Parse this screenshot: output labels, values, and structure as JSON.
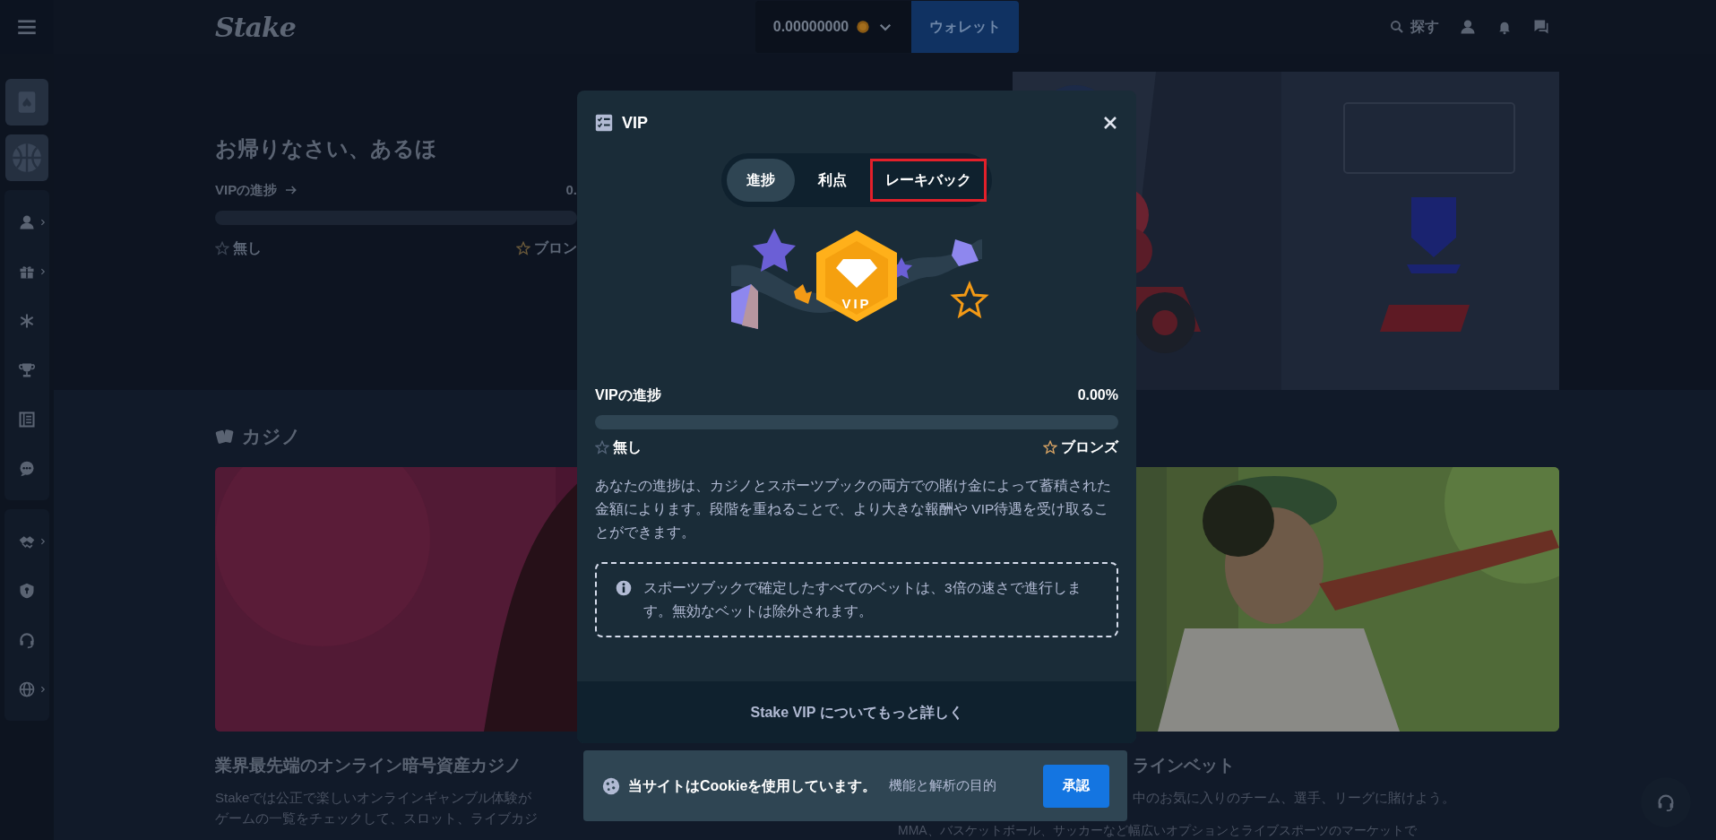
{
  "topbar": {
    "logo": "Stake",
    "balance": "0.00000000",
    "wallet_button": "ウォレット",
    "search_label": "探す"
  },
  "welcome": {
    "title": "お帰りなさい、あるほ",
    "progress_label": "VIPの進捗",
    "progress_value": "0.",
    "level": 0,
    "tier_current": "無し",
    "tier_next": "ブロン"
  },
  "casino": {
    "heading": "カジノ",
    "cards": [
      {
        "title": "業界最先端のオンライン暗号資産カジノ",
        "lines": [
          "Stakeでは公正で楽しいオンラインギャンブル体験が",
          "ゲームの一覧をチェックして、スロット、ライブカジ"
        ]
      },
      {
        "title": "ラインベット",
        "lines": [
          "中のお気に入りのチーム、選手、リーグに賭けよう。",
          "MMA、バスケットボール、サッカーなど幅広いオプションとライブスポーツのマーケットで"
        ]
      }
    ]
  },
  "modal": {
    "title": "VIP",
    "tabs": [
      {
        "label": "進捗",
        "selected": true,
        "highlighted": false
      },
      {
        "label": "利点",
        "selected": false,
        "highlighted": false
      },
      {
        "label": "レーキバック",
        "selected": false,
        "highlighted": true
      }
    ],
    "badge_label": "VIP",
    "progress": {
      "label": "VIPの進捗",
      "value": "0.00%",
      "level": 0,
      "tier_current": "無し",
      "tier_next": "ブロンズ"
    },
    "description": "あなたの進捗は、カジノとスポーツブックの両方での賭け金によって蓄積された金額によります。段階を重ねることで、より大きな報酬や VIP待遇を受け取ることができます。",
    "notice": "スポーツブックで確定したすべてのベットは、3倍の速さで進行します。無効なベットは除外されます。",
    "footer_link": "Stake VIP についてもっと詳しく"
  },
  "cookie_banner": {
    "message": "当サイトはCookieを使用しています。",
    "detail": "機能と解析の目的",
    "accept_button": "承認"
  }
}
